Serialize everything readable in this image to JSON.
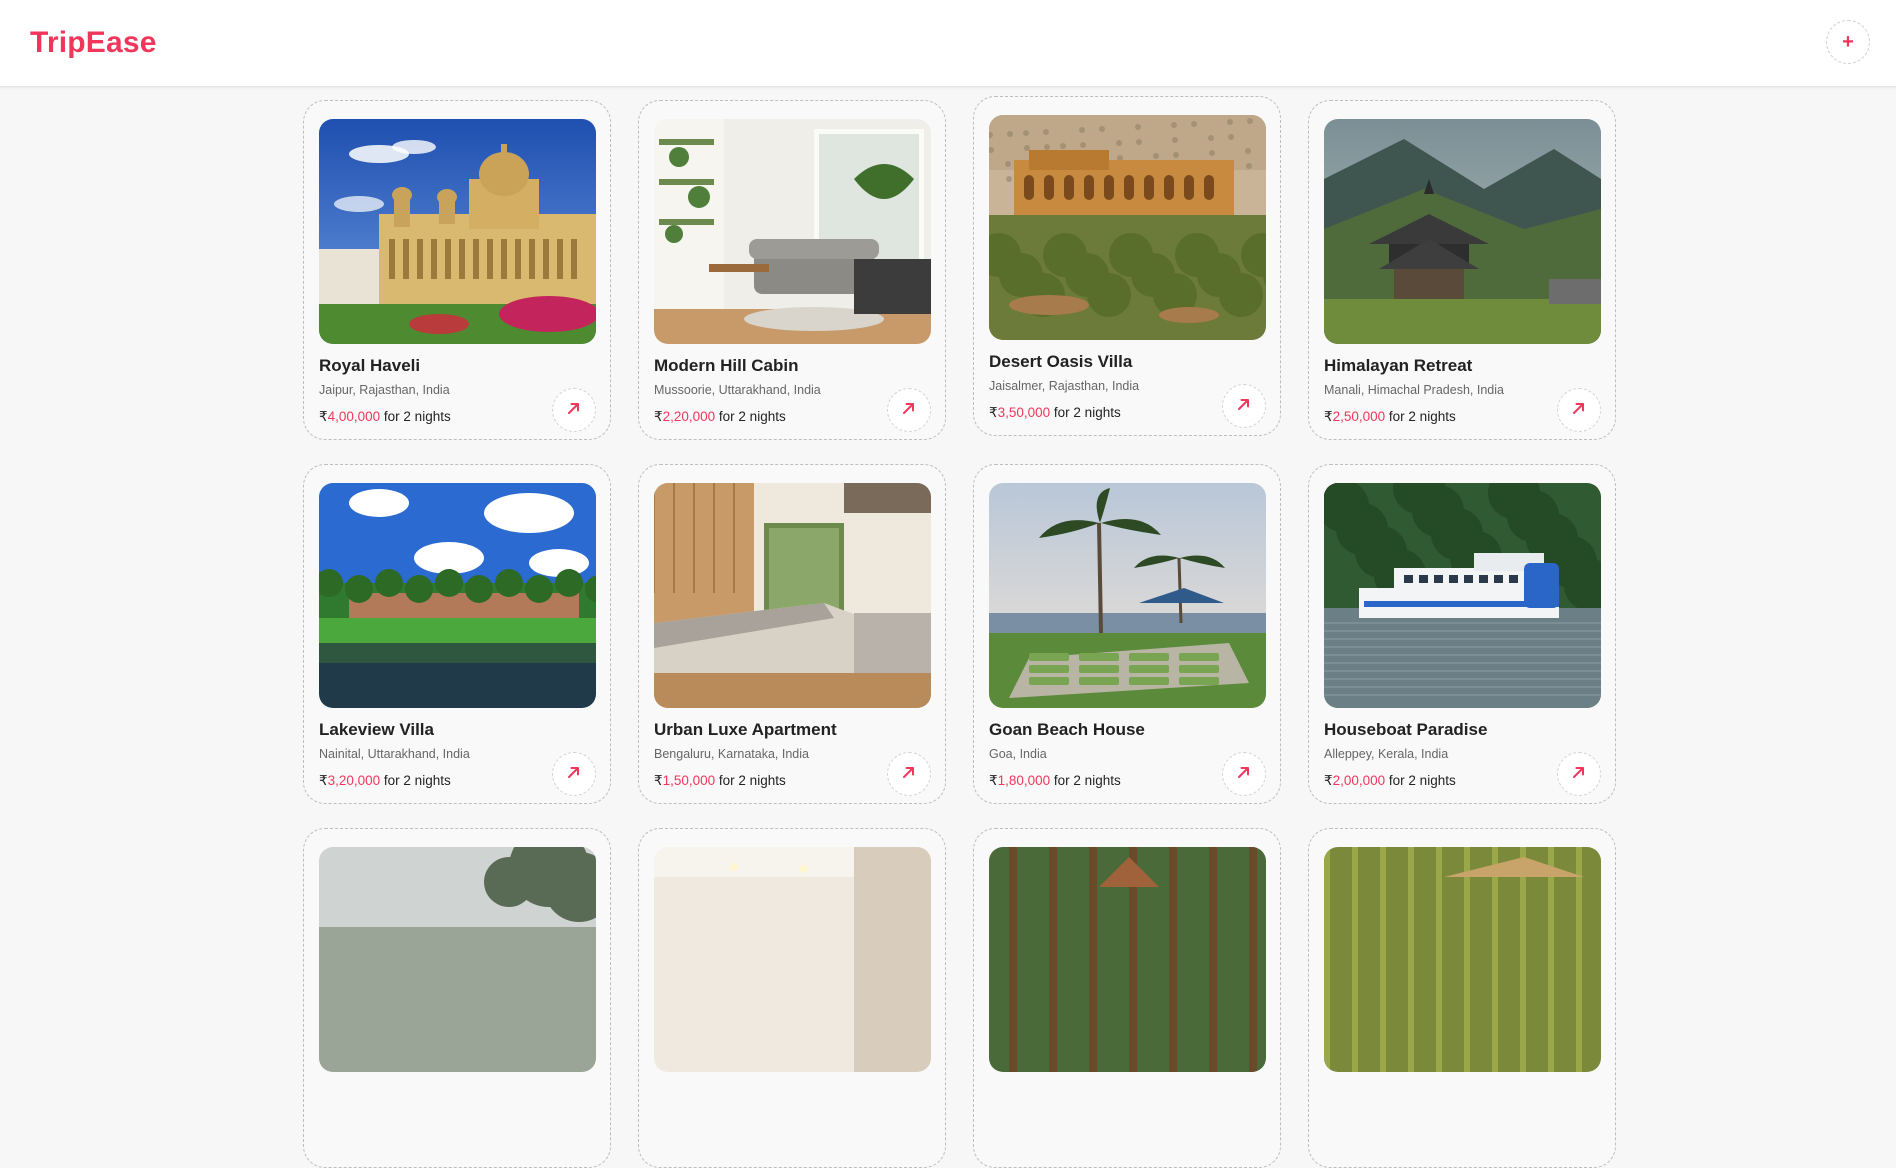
{
  "app": {
    "brand": "TripEase",
    "add_label": "+"
  },
  "currency": "₹",
  "listings": [
    {
      "title": "Royal Haveli",
      "location": "Jaipur, Rajasthan, India",
      "price": "4,00,000",
      "suffix": "for 2 nights",
      "image": "palace"
    },
    {
      "title": "Modern Hill Cabin",
      "location": "Mussoorie, Uttarakhand, India",
      "price": "2,20,000",
      "suffix": "for 2 nights",
      "image": "living-room"
    },
    {
      "title": "Desert Oasis Villa",
      "location": "Jaisalmer, Rajasthan, India",
      "price": "3,50,000",
      "suffix": "for 2 nights",
      "image": "desert-villa"
    },
    {
      "title": "Himalayan Retreat",
      "location": "Manali, Himachal Pradesh, India",
      "price": "2,50,000",
      "suffix": "for 2 nights",
      "image": "mountain-temple"
    },
    {
      "title": "Lakeview Villa",
      "location": "Nainital, Uttarakhand, India",
      "price": "3,20,000",
      "suffix": "for 2 nights",
      "image": "lake-resort"
    },
    {
      "title": "Urban Luxe Apartment",
      "location": "Bengaluru, Karnataka, India",
      "price": "1,50,000",
      "suffix": "for 2 nights",
      "image": "kitchen"
    },
    {
      "title": "Goan Beach House",
      "location": "Goa, India",
      "price": "1,80,000",
      "suffix": "for 2 nights",
      "image": "beach-garden"
    },
    {
      "title": "Houseboat Paradise",
      "location": "Alleppey, Kerala, India",
      "price": "2,00,000",
      "suffix": "for 2 nights",
      "image": "houseboat"
    },
    {
      "title": "",
      "location": "",
      "price": "",
      "suffix": "",
      "image": "misty-forest"
    },
    {
      "title": "",
      "location": "",
      "price": "",
      "suffix": "",
      "image": "bright-interior"
    },
    {
      "title": "",
      "location": "",
      "price": "",
      "suffix": "",
      "image": "forest-cabin"
    },
    {
      "title": "",
      "location": "",
      "price": "",
      "suffix": "",
      "image": "bamboo-hut"
    }
  ],
  "colors": {
    "brand": "#f1365c",
    "card_border": "#bdbdbd",
    "background": "#f7f7f7"
  },
  "icons": {
    "open": "arrow-up-right-icon",
    "add": "plus-icon"
  }
}
